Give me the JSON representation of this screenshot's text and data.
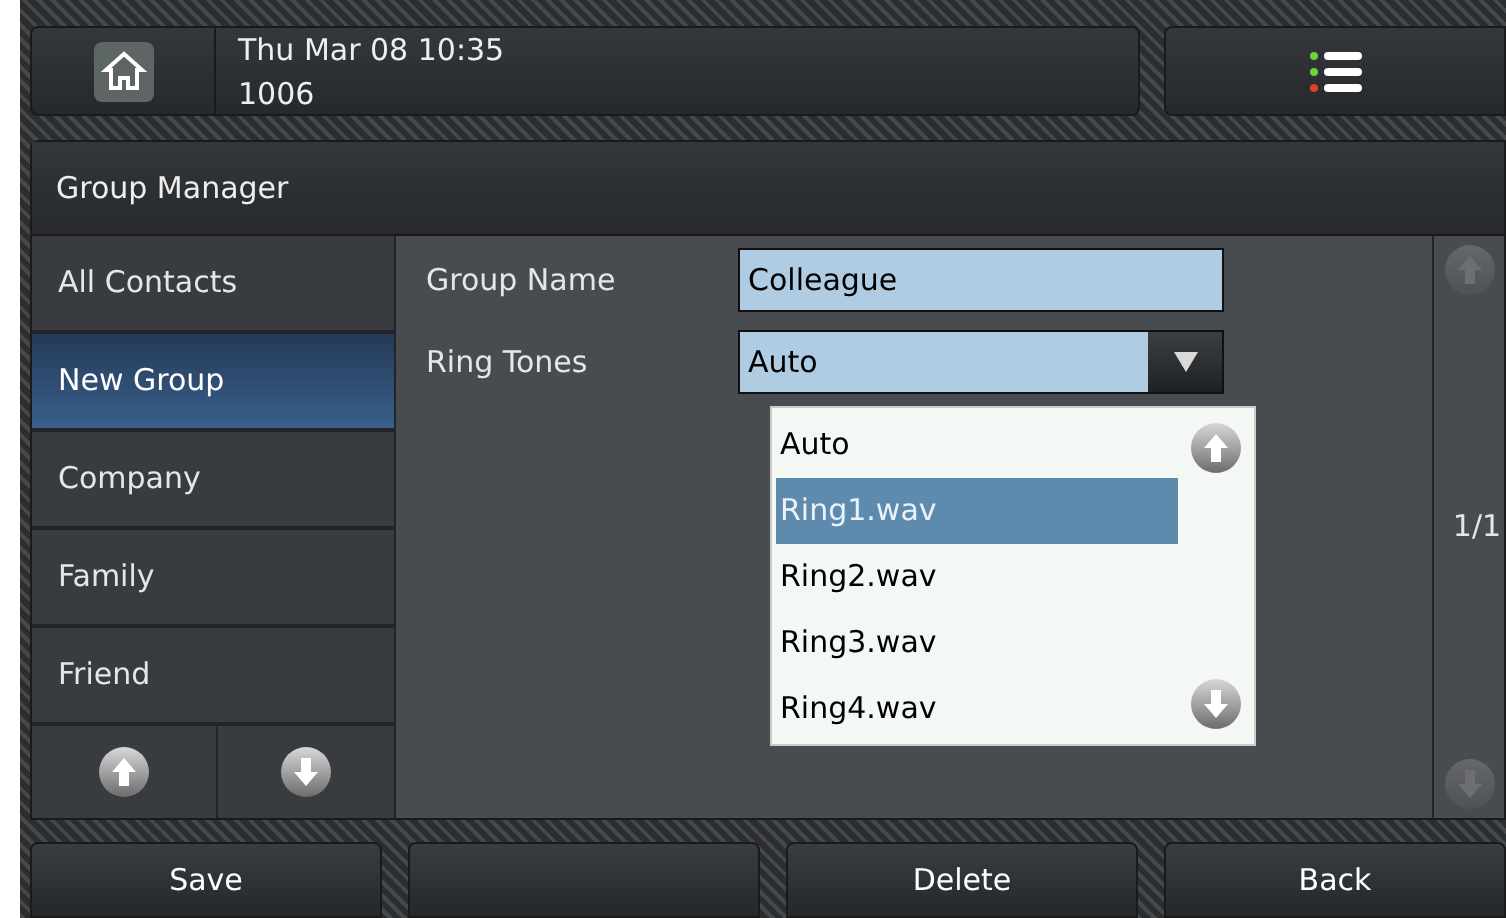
{
  "status_bar": {
    "date_time": "Thu Mar 08 10:35",
    "extension": "1006"
  },
  "title": "Group Manager",
  "sidebar": {
    "items": [
      {
        "label": "All Contacts",
        "selected": false
      },
      {
        "label": "New Group",
        "selected": true
      },
      {
        "label": "Company",
        "selected": false
      },
      {
        "label": "Family",
        "selected": false
      },
      {
        "label": "Friend",
        "selected": false
      }
    ]
  },
  "form": {
    "fields": [
      {
        "kind": "text",
        "label": "Group Name",
        "value": "Colleague"
      },
      {
        "kind": "select",
        "label": "Ring Tones",
        "value": "Auto"
      }
    ]
  },
  "dropdown": {
    "options": [
      {
        "label": "Auto",
        "selected": false
      },
      {
        "label": "Ring1.wav",
        "selected": true
      },
      {
        "label": "Ring2.wav",
        "selected": false
      },
      {
        "label": "Ring3.wav",
        "selected": false
      },
      {
        "label": "Ring4.wav",
        "selected": false
      }
    ]
  },
  "page_indicator": "1/1",
  "softkeys": [
    {
      "kind": "button",
      "label": "Save"
    },
    {
      "kind": "empty"
    },
    {
      "kind": "button",
      "label": "Delete"
    },
    {
      "kind": "button",
      "label": "Back"
    }
  ]
}
